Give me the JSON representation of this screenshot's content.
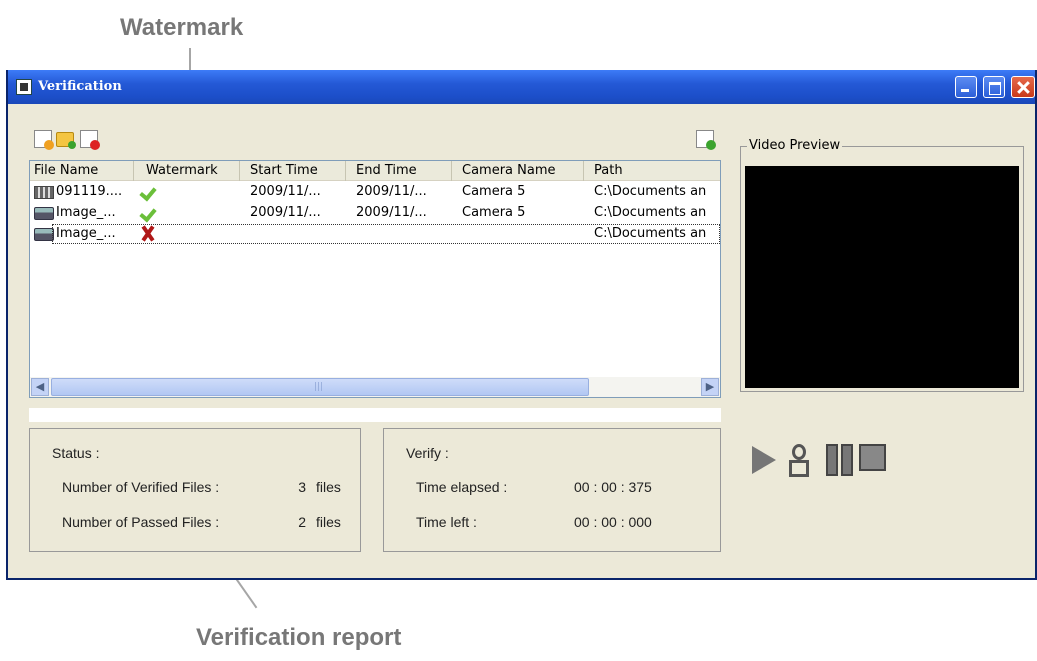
{
  "callouts": {
    "top": "Watermark",
    "bottom": "Verification report"
  },
  "window": {
    "title": "Verification",
    "title_icon": "app-icon"
  },
  "toolbar": {
    "icons": [
      "new-file-icon",
      "open-folder-icon",
      "remove-file-icon",
      "export-report-icon"
    ]
  },
  "file_list": {
    "columns": [
      "File Name",
      "Watermark",
      "Start Time",
      "End Time",
      "Camera Name",
      "Path"
    ],
    "rows": [
      {
        "icon": "film-icon",
        "name": "091119....",
        "watermark": "check-icon",
        "start": "2009/11/...",
        "end": "2009/11/...",
        "camera": "Camera 5",
        "path": "C:\\Documents an"
      },
      {
        "icon": "camera-icon",
        "name": "Image_...",
        "watermark": "check-icon",
        "start": "2009/11/...",
        "end": "2009/11/...",
        "camera": "Camera 5",
        "path": "C:\\Documents an"
      },
      {
        "icon": "camera-icon",
        "name": "Image_...",
        "watermark": "cross-icon",
        "start": "",
        "end": "",
        "camera": "",
        "path": "C:\\Documents an"
      }
    ]
  },
  "status": {
    "heading": "Status :",
    "verified_label": "Number of Verified Files :",
    "verified_count": "3",
    "verified_unit": "files",
    "passed_label": "Number of Passed Files :",
    "passed_count": "2",
    "passed_unit": "files"
  },
  "verify": {
    "heading": "Verify :",
    "elapsed_label": "Time elapsed :",
    "elapsed_value": "00 : 00 : 375",
    "left_label": "Time left :",
    "left_value": "00 : 00 : 000"
  },
  "preview": {
    "legend": "Video Preview"
  },
  "player_controls": [
    "play-icon",
    "snapshot-icon",
    "pause-icon",
    "stop-icon"
  ]
}
